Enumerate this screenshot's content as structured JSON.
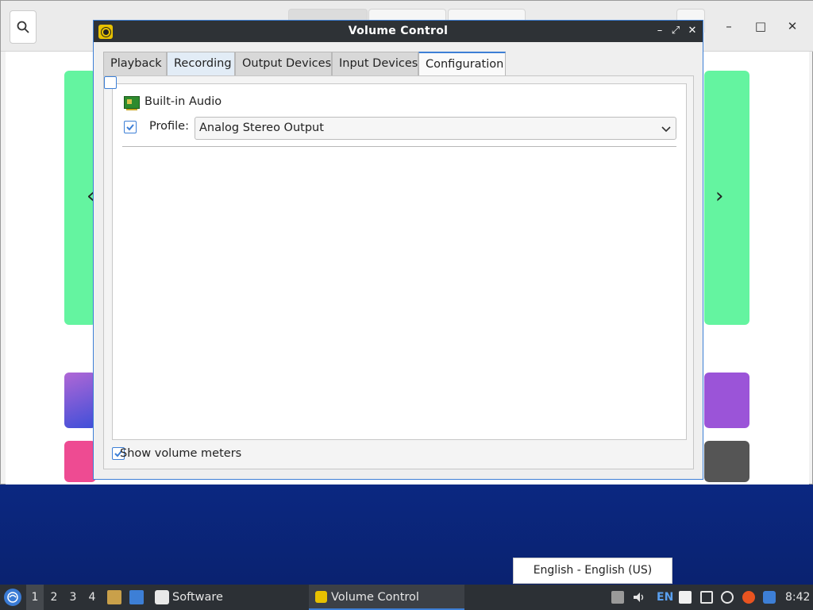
{
  "background_window": {
    "nav_prev": "‹",
    "nav_next": "›",
    "window_controls": {
      "minimize": "–",
      "maximize": "□",
      "close": "✕"
    }
  },
  "volume_control": {
    "title": "Volume Control",
    "window_controls": {
      "minimize": "–",
      "maximize": "⤢",
      "close": "✕"
    },
    "tabs": [
      {
        "label": "Playback"
      },
      {
        "label": "Recording"
      },
      {
        "label": "Output Devices"
      },
      {
        "label": "Input Devices"
      },
      {
        "label": "Configuration"
      }
    ],
    "active_tab": "Configuration",
    "device": {
      "name": "Built-in Audio",
      "enabled": true,
      "profile_label": "Profile:",
      "profile_value": "Analog Stereo Output"
    },
    "show_volume_meters": {
      "label": "Show volume meters",
      "checked": true
    }
  },
  "tooltip": {
    "text": "English - English (US)"
  },
  "taskbar": {
    "workspaces": [
      "1",
      "2",
      "3",
      "4"
    ],
    "active_workspace": "1",
    "apps": [
      {
        "label": "Software",
        "icon": "software-center-icon"
      },
      {
        "label": "Volume Control",
        "icon": "volume-control-icon"
      }
    ],
    "tray": {
      "keyboard_layout": "EN",
      "clock": "8:42"
    }
  },
  "colors": {
    "accent": "#3d7fd6",
    "titlebar": "#2e3236",
    "taskbar": "#2c3035"
  }
}
